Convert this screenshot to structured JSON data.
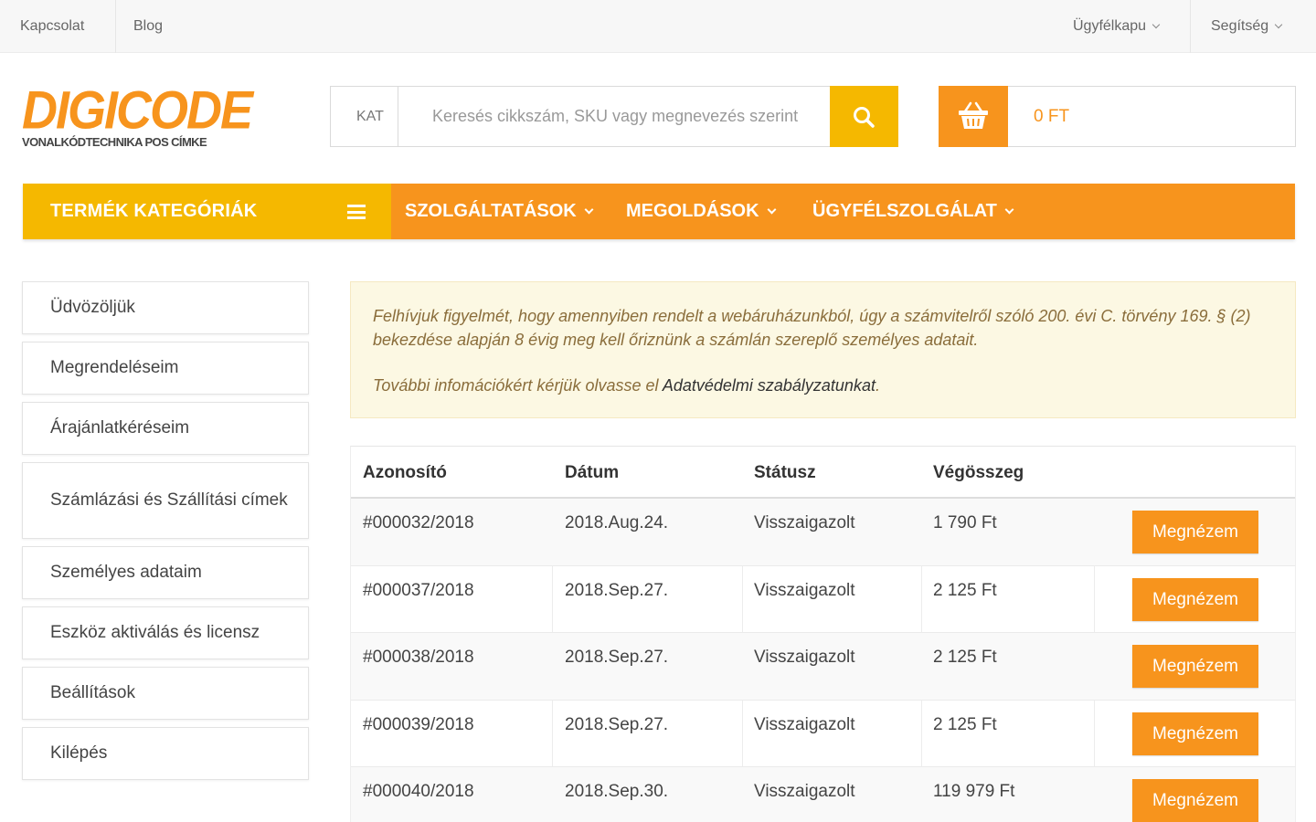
{
  "topbar": {
    "left_links": [
      "Kapcsolat",
      "Blog"
    ],
    "right_menus": [
      "Ügyfélkapu",
      "Segítség"
    ]
  },
  "logo": {
    "name": "DIGICODE",
    "tagline": "VONALKÓDTECHNIKA POS CÍMKE"
  },
  "search": {
    "category_label": "KAT",
    "placeholder": "Keresés cikkszám, SKU vagy megnevezés szerint",
    "button_icon": "search-icon"
  },
  "cart": {
    "icon": "basket-icon",
    "amount": "0 FT"
  },
  "nav": {
    "categories_label": "TERMÉK KATEGÓRIÁK",
    "items": [
      "SZOLGÁLTATÁSOK",
      "MEGOLDÁSOK",
      "ÜGYFÉLSZOLGÁLAT"
    ]
  },
  "sidebar": {
    "items": [
      "Üdvözöljük",
      "Megrendeléseim",
      "Árajánlatkéréseim",
      "Számlázási és Szállítási címek",
      "Személyes adataim",
      "Eszköz aktiválás és licensz",
      "Beállítások",
      "Kilépés"
    ]
  },
  "notice": {
    "line1": "Felhívjuk figyelmét, hogy amennyiben rendelt a webáruházunkból, úgy a számvitelről szóló 200. évi C. törvény 169. § (2) bekezdése alapján 8 évig meg kell őriznünk a számlán szereplő személyes adatait.",
    "line2_prefix": "További infomációkért kérjük olvasse el ",
    "line2_link": "Adatvédelmi szabályzatunkat",
    "line2_suffix": "."
  },
  "orders": {
    "columns": [
      "Azonosító",
      "Dátum",
      "Státusz",
      "Végösszeg",
      ""
    ],
    "button_label": "Megnézem",
    "rows": [
      {
        "id": "#000032/2018",
        "date": "2018.Aug.24.",
        "status": "Visszaigazolt",
        "total": "1 790 Ft"
      },
      {
        "id": "#000037/2018",
        "date": "2018.Sep.27.",
        "status": "Visszaigazolt",
        "total": "2 125 Ft"
      },
      {
        "id": "#000038/2018",
        "date": "2018.Sep.27.",
        "status": "Visszaigazolt",
        "total": "2 125 Ft"
      },
      {
        "id": "#000039/2018",
        "date": "2018.Sep.27.",
        "status": "Visszaigazolt",
        "total": "2 125 Ft"
      },
      {
        "id": "#000040/2018",
        "date": "2018.Sep.30.",
        "status": "Visszaigazolt",
        "total": "119 979 Ft"
      }
    ]
  },
  "colors": {
    "orange": "#f7941d",
    "yellow": "#f5b800",
    "notice_bg": "#fcf8e3",
    "notice_text": "#8a6d3b"
  }
}
